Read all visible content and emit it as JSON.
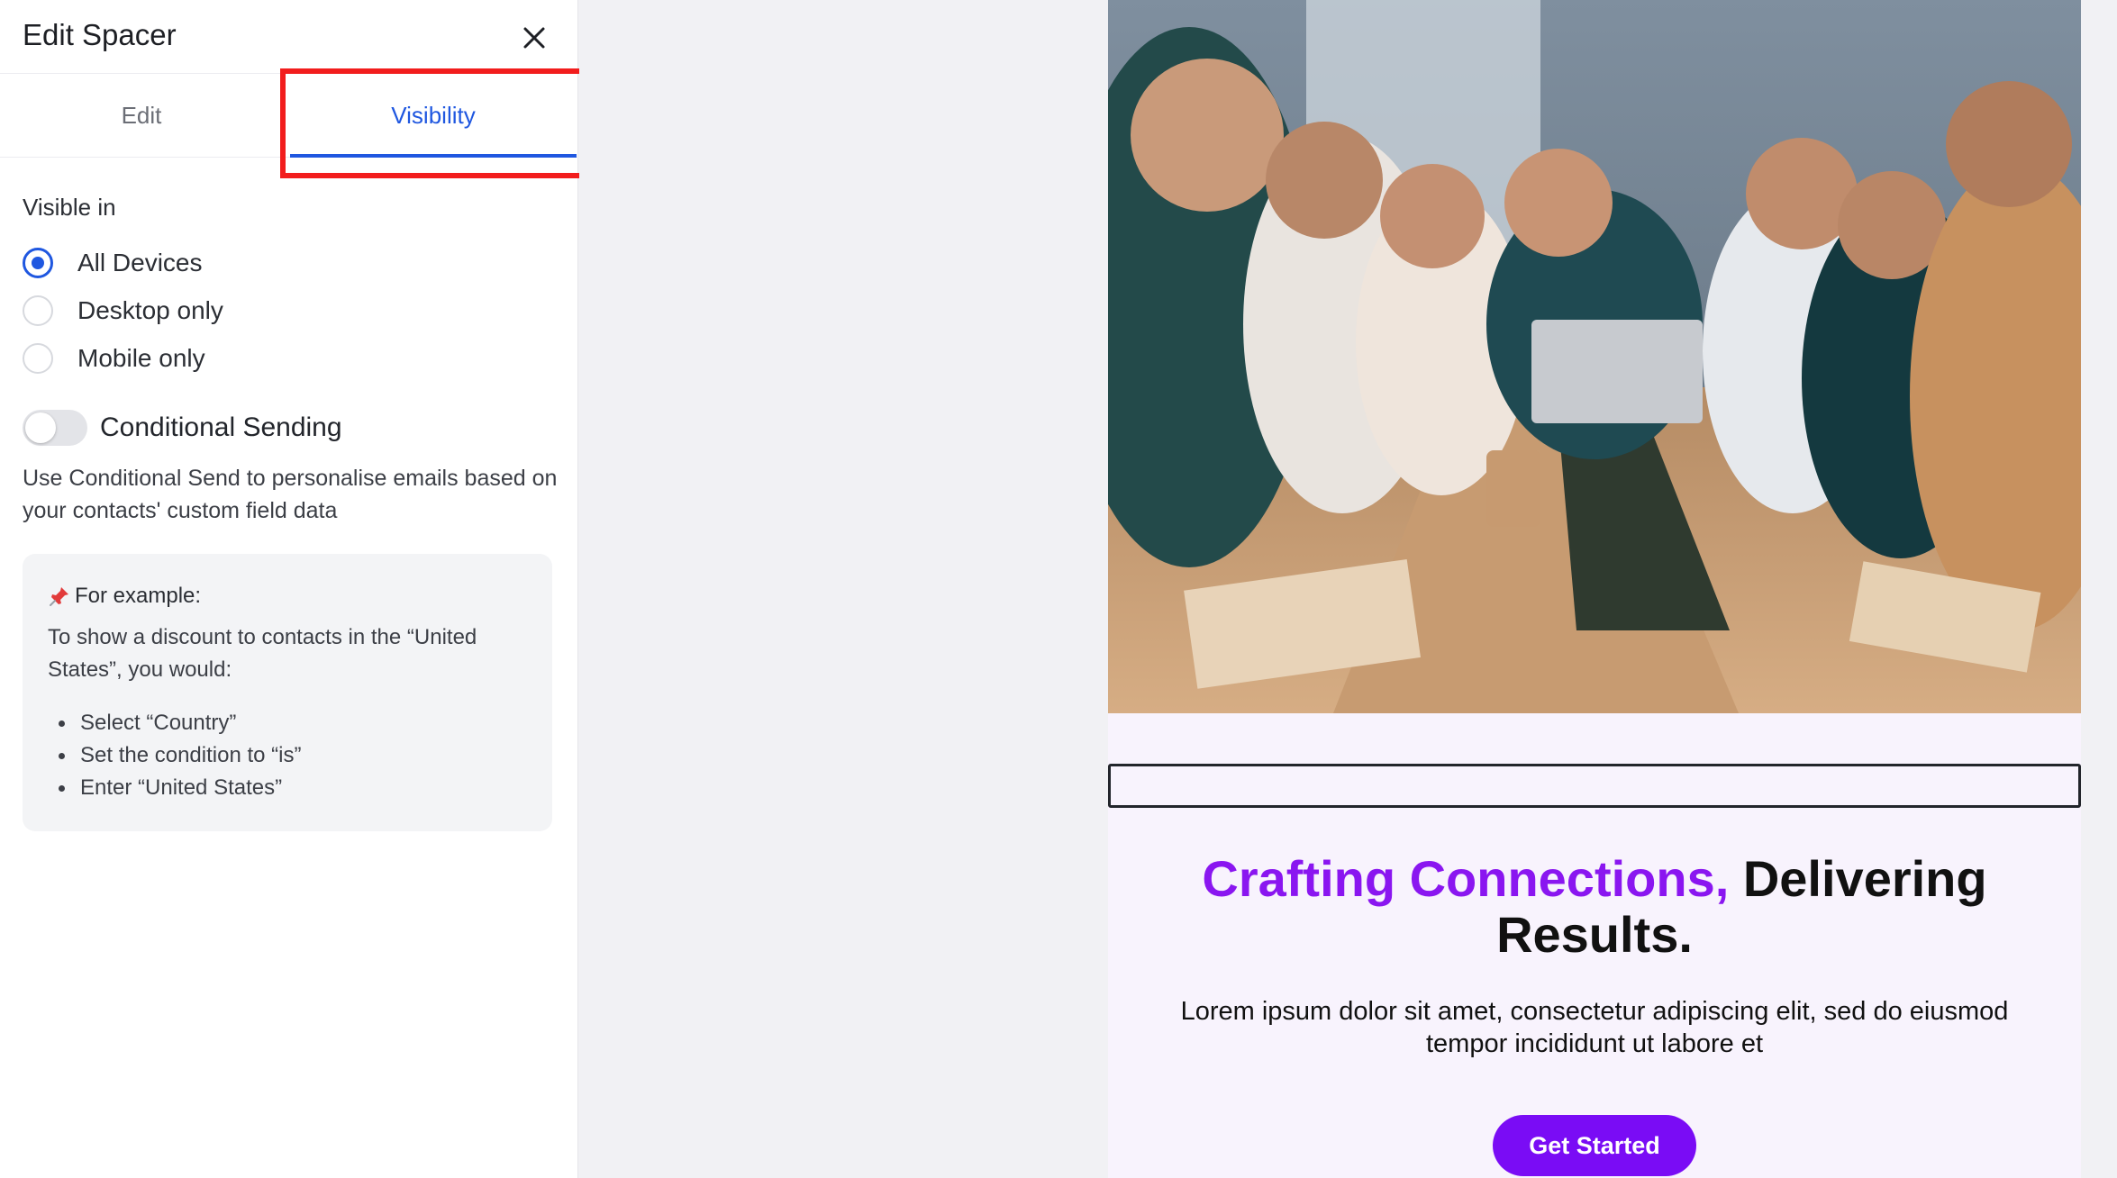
{
  "panel": {
    "title": "Edit Spacer",
    "tabs": [
      {
        "label": "Edit",
        "active": false
      },
      {
        "label": "Visibility",
        "active": true
      }
    ],
    "visible_in_label": "Visible in",
    "options": [
      {
        "label": "All Devices",
        "selected": true
      },
      {
        "label": "Desktop only",
        "selected": false
      },
      {
        "label": "Mobile only",
        "selected": false
      }
    ],
    "conditional": {
      "label": "Conditional Sending",
      "enabled": false,
      "description": "Use Conditional Send to personalise emails based on your contacts' custom field data"
    },
    "example": {
      "icon": "pushpin-icon",
      "title": "For example:",
      "text": "To show a discount to contacts in the “United States”, you would:",
      "steps": [
        "Select “Country”",
        "Set the condition to “is”",
        "Enter “United States”"
      ]
    }
  },
  "preview": {
    "headline_accent": "Crafting Connections,",
    "headline_rest": " Delivering Results.",
    "body": "Lorem ipsum dolor sit amet, consectetur adipiscing elit, sed do eiusmod tempor incididunt ut labore et",
    "cta": "Get Started",
    "colors": {
      "accent": "#8a16f0",
      "button": "#7a0cf5",
      "email_bg": "#f8f3fd",
      "tab_active": "#1f57e0",
      "highlight": "#f21d1d"
    }
  }
}
